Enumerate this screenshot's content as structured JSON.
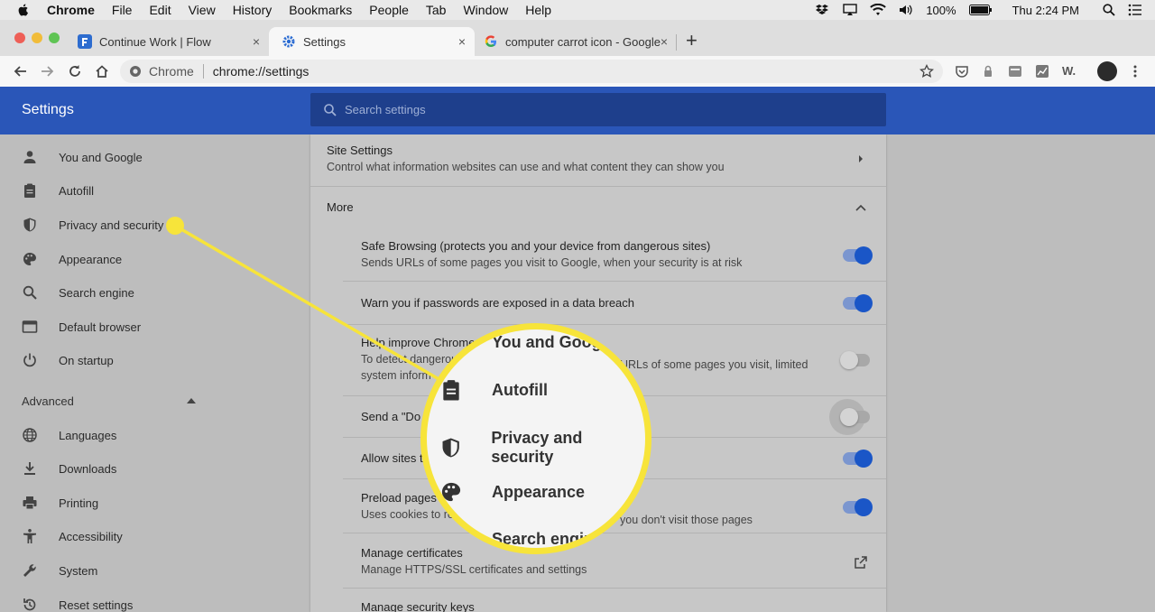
{
  "menubar": {
    "app": "Chrome",
    "items": [
      "File",
      "Edit",
      "View",
      "History",
      "Bookmarks",
      "People",
      "Tab",
      "Window",
      "Help"
    ],
    "battery": "100%",
    "clock": "Thu 2:24 PM"
  },
  "tabs": [
    {
      "title": "Continue Work | Flow",
      "close": "×"
    },
    {
      "title": "Settings",
      "close": "×"
    },
    {
      "title": "computer carrot icon - Google",
      "close": "×"
    }
  ],
  "new_tab": "+",
  "omnibox": {
    "chip": "Chrome",
    "url": "chrome://settings"
  },
  "ext_label": "W.",
  "settings": {
    "title": "Settings",
    "search_placeholder": "Search settings"
  },
  "sidebar": {
    "items": [
      {
        "label": "You and Google",
        "icon": "person-icon"
      },
      {
        "label": "Autofill",
        "icon": "clipboard-icon"
      },
      {
        "label": "Privacy and security",
        "icon": "shield-icon"
      },
      {
        "label": "Appearance",
        "icon": "palette-icon"
      },
      {
        "label": "Search engine",
        "icon": "search-icon"
      },
      {
        "label": "Default browser",
        "icon": "browser-icon"
      },
      {
        "label": "On startup",
        "icon": "power-icon"
      }
    ],
    "advanced_label": "Advanced",
    "advanced_items": [
      {
        "label": "Languages",
        "icon": "globe-icon"
      },
      {
        "label": "Downloads",
        "icon": "download-icon"
      },
      {
        "label": "Printing",
        "icon": "printer-icon"
      },
      {
        "label": "Accessibility",
        "icon": "accessibility-icon"
      },
      {
        "label": "System",
        "icon": "wrench-icon"
      },
      {
        "label": "Reset settings",
        "icon": "reset-icon"
      }
    ]
  },
  "panel": {
    "site_settings_title": "Site Settings",
    "site_settings_sub": "Control what information websites can use and what content they can show you",
    "more_label": "More",
    "rows": [
      {
        "title": "Safe Browsing (protects you and your device from dangerous sites)",
        "sub": "Sends URLs of some pages you visit to Google, when your security is at risk",
        "on": true
      },
      {
        "title": "Warn you if passwords are exposed in a data breach",
        "sub": "",
        "on": true
      },
      {
        "title": "Help improve Chrome s",
        "sub": "To detect dangerou",
        "sub_right": "URLs of some pages you visit, limited",
        "sub2": "system inform",
        "on": false
      },
      {
        "title": "Send a \"Do N",
        "sub": "",
        "on": false
      },
      {
        "title": "Allow sites t",
        "sub": "",
        "on": true
      },
      {
        "title": "Preload pages f",
        "sub": "Uses cookies to re",
        "sub_right": "you don't visit those pages",
        "on": true
      }
    ],
    "certs_title": "Manage certificates",
    "certs_sub": "Manage HTTPS/SSL certificates and settings",
    "keys_title": "Manage security keys"
  },
  "magnifier": {
    "items": [
      "You and Goog",
      "Autofill",
      "Privacy and security",
      "Appearance",
      "Search engin"
    ]
  },
  "colors": {
    "accent": "#2a56b8",
    "callout": "#f7e43a",
    "toggle_on": "#1a56c7"
  }
}
